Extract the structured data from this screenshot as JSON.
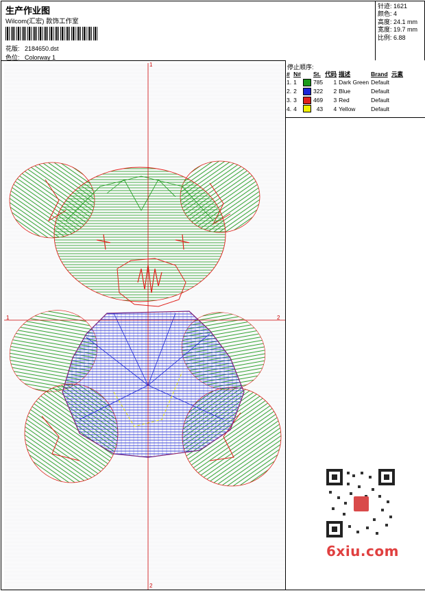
{
  "header": {
    "title": "生产作业图",
    "company": "Wilcom(汇宏) 款饰工作室",
    "design_label": "花版:",
    "design_value": "2184650.dst",
    "colorway_label": "色位:",
    "colorway_value": "Colorway 1"
  },
  "stats": {
    "stitches_label": "针迹:",
    "stitches_value": "1621",
    "colors_label": "颜色:",
    "colors_value": "4",
    "height_label": "高度:",
    "height_value": "24.1 mm",
    "width_label": "宽度:",
    "width_value": "19.7 mm",
    "scale_label": "比例:",
    "scale_value": "6.88"
  },
  "stop_sequence": {
    "title": "停止顺序:",
    "columns": [
      "#",
      "N#",
      "St.",
      "代码",
      "描述",
      "Brand",
      "元素"
    ],
    "rows": [
      {
        "idx": "1.",
        "n": "1",
        "color": "#1a9a1a",
        "st": "785",
        "code": "1",
        "desc": "Dark Green",
        "brand": "Default"
      },
      {
        "idx": "2.",
        "n": "2",
        "color": "#1a24d6",
        "st": "322",
        "code": "2",
        "desc": "Blue",
        "brand": "Default"
      },
      {
        "idx": "3.",
        "n": "3",
        "color": "#e0201a",
        "st": "469",
        "code": "3",
        "desc": "Red",
        "brand": "Default"
      },
      {
        "idx": "4.",
        "n": "4",
        "color": "#f0f000",
        "st": "43",
        "code": "4",
        "desc": "Yellow",
        "brand": "Default"
      }
    ]
  },
  "axis": {
    "top": "1",
    "bottom": "2",
    "left": "1",
    "right": "2"
  },
  "watermark": {
    "site": "6xiu.com"
  },
  "colors": {
    "green": "#1a9a1a",
    "blue": "#1a24d6",
    "red": "#e0201a",
    "yellow": "#e8e800",
    "axis": "#cc0000"
  }
}
